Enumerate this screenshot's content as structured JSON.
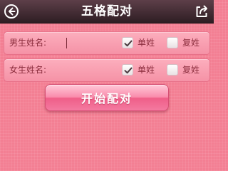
{
  "header": {
    "title": "五格配对",
    "back_icon": "back-arrow-circle-icon",
    "share_icon": "share-export-icon"
  },
  "male_row": {
    "label": "男生姓名:",
    "input_value": "",
    "options": [
      {
        "label": "单姓",
        "checked": true
      },
      {
        "label": "复姓",
        "checked": false
      }
    ]
  },
  "female_row": {
    "label": "女生姓名:",
    "input_value": "",
    "options": [
      {
        "label": "单姓",
        "checked": true
      },
      {
        "label": "复姓",
        "checked": false
      }
    ]
  },
  "match_button": {
    "label": "开始配对"
  },
  "colors": {
    "background": "#f37f93",
    "header": "#3b2730",
    "row": "#fcaebd",
    "label_text": "#8a2c3c",
    "button_accent": "#ef5e88"
  }
}
